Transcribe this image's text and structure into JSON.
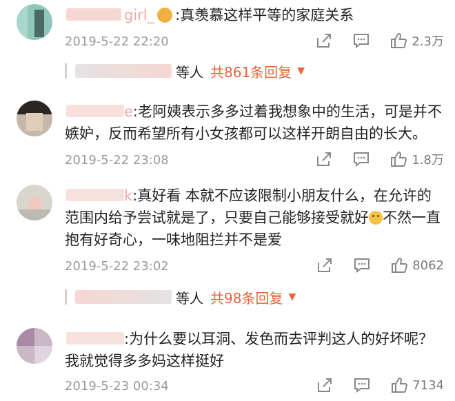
{
  "comments": [
    {
      "username": "girl_",
      "text": ":真羡慕这样平等的家庭关系",
      "time": "2019-5-22 22:20",
      "likes": "2.3万",
      "replies": {
        "who": "等人",
        "total": "共861条回复"
      }
    },
    {
      "username": "e",
      "text": ":老阿姨表示多多过着我想象中的生活，可是并不嫉妒，反而希望所有小女孩都可以这样开朗自由的长大。",
      "time": "2019-5-22 23:08",
      "likes": "1.8万"
    },
    {
      "username": "k",
      "text": ":真好看 本就不应该限制小朋友什么，在允许的范围内给予尝试就是了，只要自己能够接受就好",
      "text_tail": "不然一直抱有好奇心，一味地阻拦并不是爱",
      "time": "2019-5-22 23:02",
      "likes": "8062",
      "replies": {
        "who": "等人",
        "total": "共98条回复"
      }
    },
    {
      "username": "",
      "text": ":为什么要以耳洞、发色而去评判这人的好坏呢？我就觉得多多妈这样挺好",
      "time": "2019-5-23 00:34",
      "likes": "7134"
    }
  ],
  "icons": {
    "share": "share-icon",
    "comment": "comment-icon",
    "like": "thumbs-up-icon",
    "expand": "caret-down-icon"
  },
  "colors": {
    "accent": "#e8653a",
    "meta": "#9a9a9a",
    "username": "#f2a8a0"
  }
}
